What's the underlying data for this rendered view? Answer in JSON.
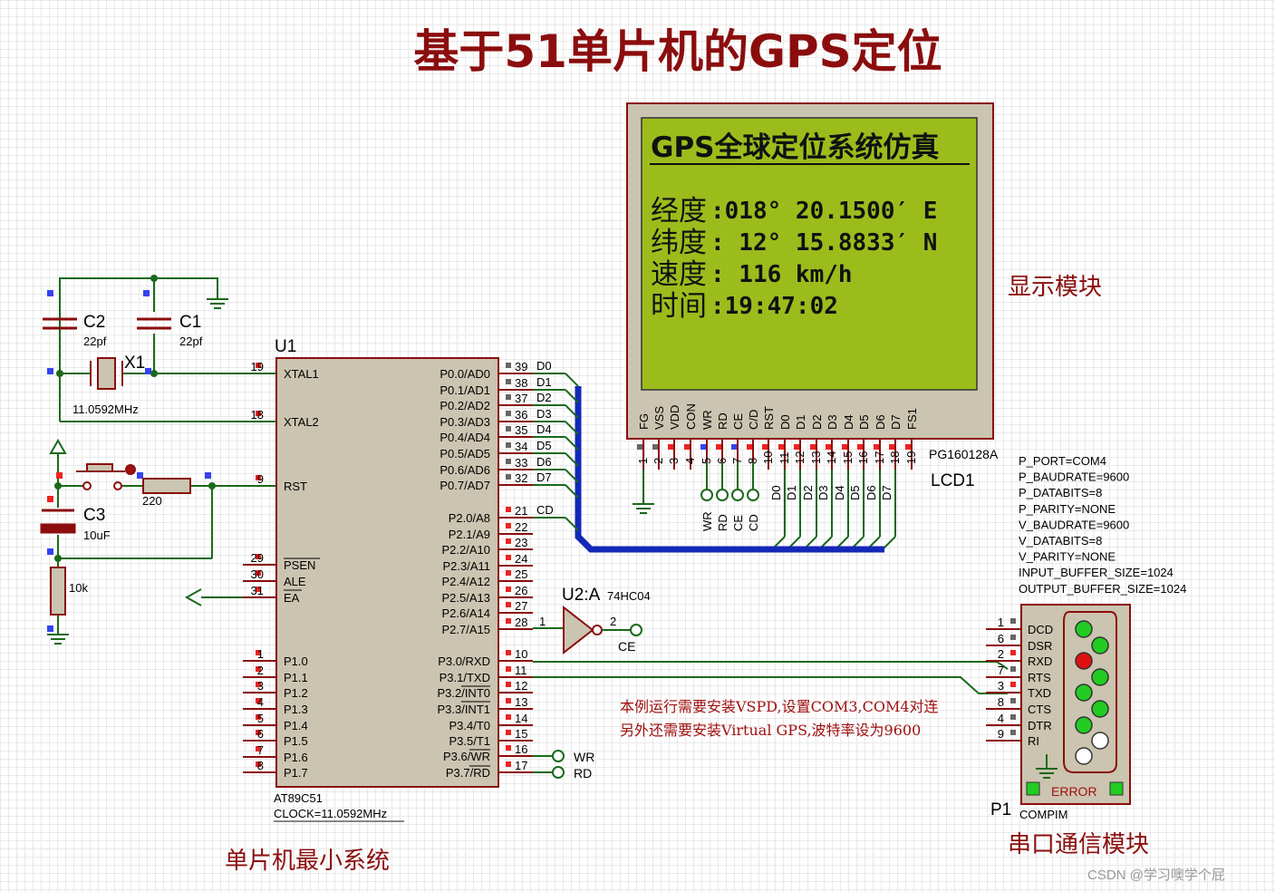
{
  "title": "基于51单片机的GPS定位",
  "labels": {
    "display": "显示模块",
    "mcu": "单片机最小系统",
    "serial": "串口通信模块"
  },
  "note": {
    "line1": "本例运行需要安装VSPD,设置COM3,COM4对连",
    "line2": "另外还需要安装Virtual GPS,波特率设为9600"
  },
  "lcd": {
    "header": "GPS全球定位系统仿真",
    "rows": [
      {
        "label": "经度",
        "value": ":018° 20.1500′ E"
      },
      {
        "label": "纬度",
        "value": ": 12° 15.8833′ N"
      },
      {
        "label": "速度",
        "value": ": 116 km/h"
      },
      {
        "label": "时间",
        "value": ":19:47:02"
      }
    ],
    "pin_names": [
      "FG",
      "VSS",
      "VDD",
      "CON",
      "WR",
      "RD",
      "CE",
      "C/D",
      "RST",
      "D0",
      "D1",
      "D2",
      "D3",
      "D4",
      "D5",
      "D6",
      "D7",
      "FS1"
    ],
    "pin_numbers": [
      "1",
      "2",
      "3",
      "4",
      "5",
      "6",
      "7",
      "8",
      "10",
      "11",
      "12",
      "13",
      "14",
      "15",
      "16",
      "17",
      "18",
      "19"
    ],
    "part": "PG160128A",
    "ref": "LCD1",
    "bus_labels": [
      "D0",
      "D1",
      "D2",
      "D3",
      "D4",
      "D5",
      "D6",
      "D7"
    ],
    "ctrl_labels": [
      "WR",
      "RD",
      "CE",
      "CD"
    ]
  },
  "mcu": {
    "ref": "U1",
    "part": "AT89C51",
    "clock": "CLOCK=11.0592MHz",
    "left_pins": [
      {
        "num": "19",
        "name": "XTAL1"
      },
      {
        "num": "18",
        "name": "XTAL2"
      },
      {
        "num": "9",
        "name": "RST"
      },
      {
        "num": "29",
        "name": "PSEN"
      },
      {
        "num": "30",
        "name": "ALE"
      },
      {
        "num": "31",
        "name": "EA"
      },
      {
        "num": "1",
        "name": "P1.0"
      },
      {
        "num": "2",
        "name": "P1.1"
      },
      {
        "num": "3",
        "name": "P1.2"
      },
      {
        "num": "4",
        "name": "P1.3"
      },
      {
        "num": "5",
        "name": "P1.4"
      },
      {
        "num": "6",
        "name": "P1.5"
      },
      {
        "num": "7",
        "name": "P1.6"
      },
      {
        "num": "8",
        "name": "P1.7"
      }
    ],
    "right_pins": [
      {
        "num": "39",
        "name": "P0.0/AD0",
        "net": "D0"
      },
      {
        "num": "38",
        "name": "P0.1/AD1",
        "net": "D1"
      },
      {
        "num": "37",
        "name": "P0.2/AD2",
        "net": "D2"
      },
      {
        "num": "36",
        "name": "P0.3/AD3",
        "net": "D3"
      },
      {
        "num": "35",
        "name": "P0.4/AD4",
        "net": "D4"
      },
      {
        "num": "34",
        "name": "P0.5/AD5",
        "net": "D5"
      },
      {
        "num": "33",
        "name": "P0.6/AD6",
        "net": "D6"
      },
      {
        "num": "32",
        "name": "P0.7/AD7",
        "net": "D7"
      },
      {
        "num": "21",
        "name": "P2.0/A8",
        "net": "CD"
      },
      {
        "num": "22",
        "name": "P2.1/A9",
        "net": ""
      },
      {
        "num": "23",
        "name": "P2.2/A10",
        "net": ""
      },
      {
        "num": "24",
        "name": "P2.3/A11",
        "net": ""
      },
      {
        "num": "25",
        "name": "P2.4/A12",
        "net": ""
      },
      {
        "num": "26",
        "name": "P2.5/A13",
        "net": ""
      },
      {
        "num": "27",
        "name": "P2.6/A14",
        "net": ""
      },
      {
        "num": "28",
        "name": "P2.7/A15",
        "net": ""
      },
      {
        "num": "10",
        "name": "P3.0/RXD",
        "net": ""
      },
      {
        "num": "11",
        "name": "P3.1/TXD",
        "net": ""
      },
      {
        "num": "12",
        "name": "P3.2/INT0",
        "net": ""
      },
      {
        "num": "13",
        "name": "P3.3/INT1",
        "net": ""
      },
      {
        "num": "14",
        "name": "P3.4/T0",
        "net": ""
      },
      {
        "num": "15",
        "name": "P3.5/T1",
        "net": ""
      },
      {
        "num": "16",
        "name": "P3.6/WR",
        "net": "WR"
      },
      {
        "num": "17",
        "name": "P3.7/RD",
        "net": "RD"
      }
    ]
  },
  "components": {
    "c2": {
      "ref": "C2",
      "value": "22pf"
    },
    "c1": {
      "ref": "C1",
      "value": "22pf"
    },
    "x1": {
      "ref": "X1",
      "value": "11.0592MHz"
    },
    "r_rst": {
      "value": "220"
    },
    "c3": {
      "ref": "C3",
      "value": "10uF"
    },
    "r10k": {
      "value": "10k"
    }
  },
  "inverter": {
    "ref": "U2:A",
    "part": "74HC04",
    "pin_in": "1",
    "pin_out": "2",
    "net": "CE"
  },
  "compim": {
    "ref": "P1",
    "part": "COMPIM",
    "error": "ERROR",
    "props": [
      "P_PORT=COM4",
      "P_BAUDRATE=9600",
      "P_DATABITS=8",
      "P_PARITY=NONE",
      "V_BAUDRATE=9600",
      "V_DATABITS=8",
      "V_PARITY=NONE",
      "INPUT_BUFFER_SIZE=1024",
      "OUTPUT_BUFFER_SIZE=1024"
    ],
    "pins": [
      {
        "num": "1",
        "name": "DCD"
      },
      {
        "num": "6",
        "name": "DSR"
      },
      {
        "num": "2",
        "name": "RXD"
      },
      {
        "num": "7",
        "name": "RTS"
      },
      {
        "num": "3",
        "name": "TXD"
      },
      {
        "num": "8",
        "name": "CTS"
      },
      {
        "num": "4",
        "name": "DTR"
      },
      {
        "num": "9",
        "name": "RI"
      }
    ],
    "led_colors": [
      "#22cc22",
      "#22cc22",
      "#dd1111",
      "#22cc22",
      "#22cc22",
      "#22cc22",
      "#22cc22",
      "#ffffff"
    ]
  },
  "watermark": "CSDN @学习噢学个屁",
  "colors": {
    "body": "#cbc4b0",
    "outline": "#8b0d0d",
    "wire": "#1a6a1a",
    "bus": "#1428b8",
    "lcd_screen": "#9cbc1c"
  }
}
